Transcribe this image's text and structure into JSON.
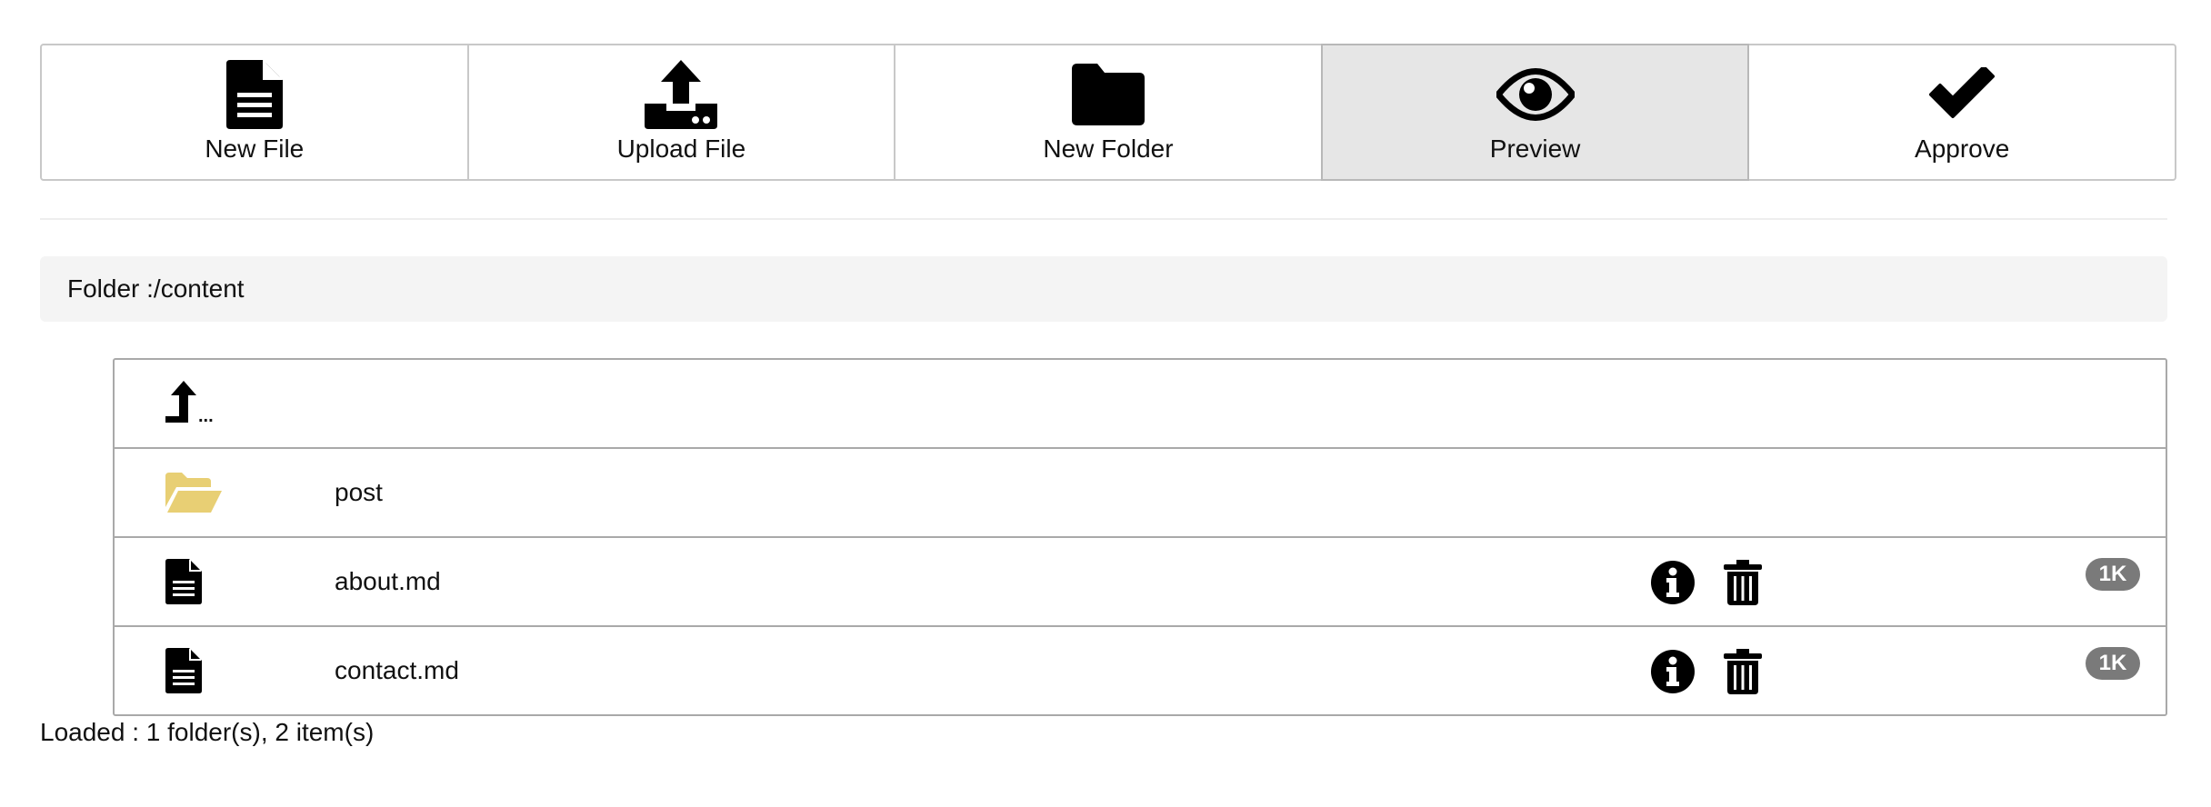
{
  "toolbar": {
    "buttons": [
      {
        "label": "New File",
        "icon": "file-icon"
      },
      {
        "label": "Upload File",
        "icon": "upload-icon"
      },
      {
        "label": "New Folder",
        "icon": "folder-icon"
      },
      {
        "label": "Preview",
        "icon": "eye-icon",
        "active": true
      },
      {
        "label": "Approve",
        "icon": "check-icon"
      }
    ]
  },
  "breadcrumb": {
    "text": "Folder :/content"
  },
  "files": {
    "up": {
      "label": "...",
      "icon": "level-up-icon"
    },
    "rows": [
      {
        "name": "post",
        "type": "folder",
        "icon": "folder-open-icon",
        "icon_color": "#e8cf74"
      },
      {
        "name": "about.md",
        "type": "file",
        "icon": "file-text-icon",
        "size": "1K"
      },
      {
        "name": "contact.md",
        "type": "file",
        "icon": "file-text-icon",
        "size": "1K"
      }
    ]
  },
  "status": {
    "text": "Loaded : 1 folder(s), 2 item(s)"
  },
  "colors": {
    "badge": "#7a7a7a",
    "folder": "#e8cf74",
    "active_button": "#e6e6e6"
  }
}
